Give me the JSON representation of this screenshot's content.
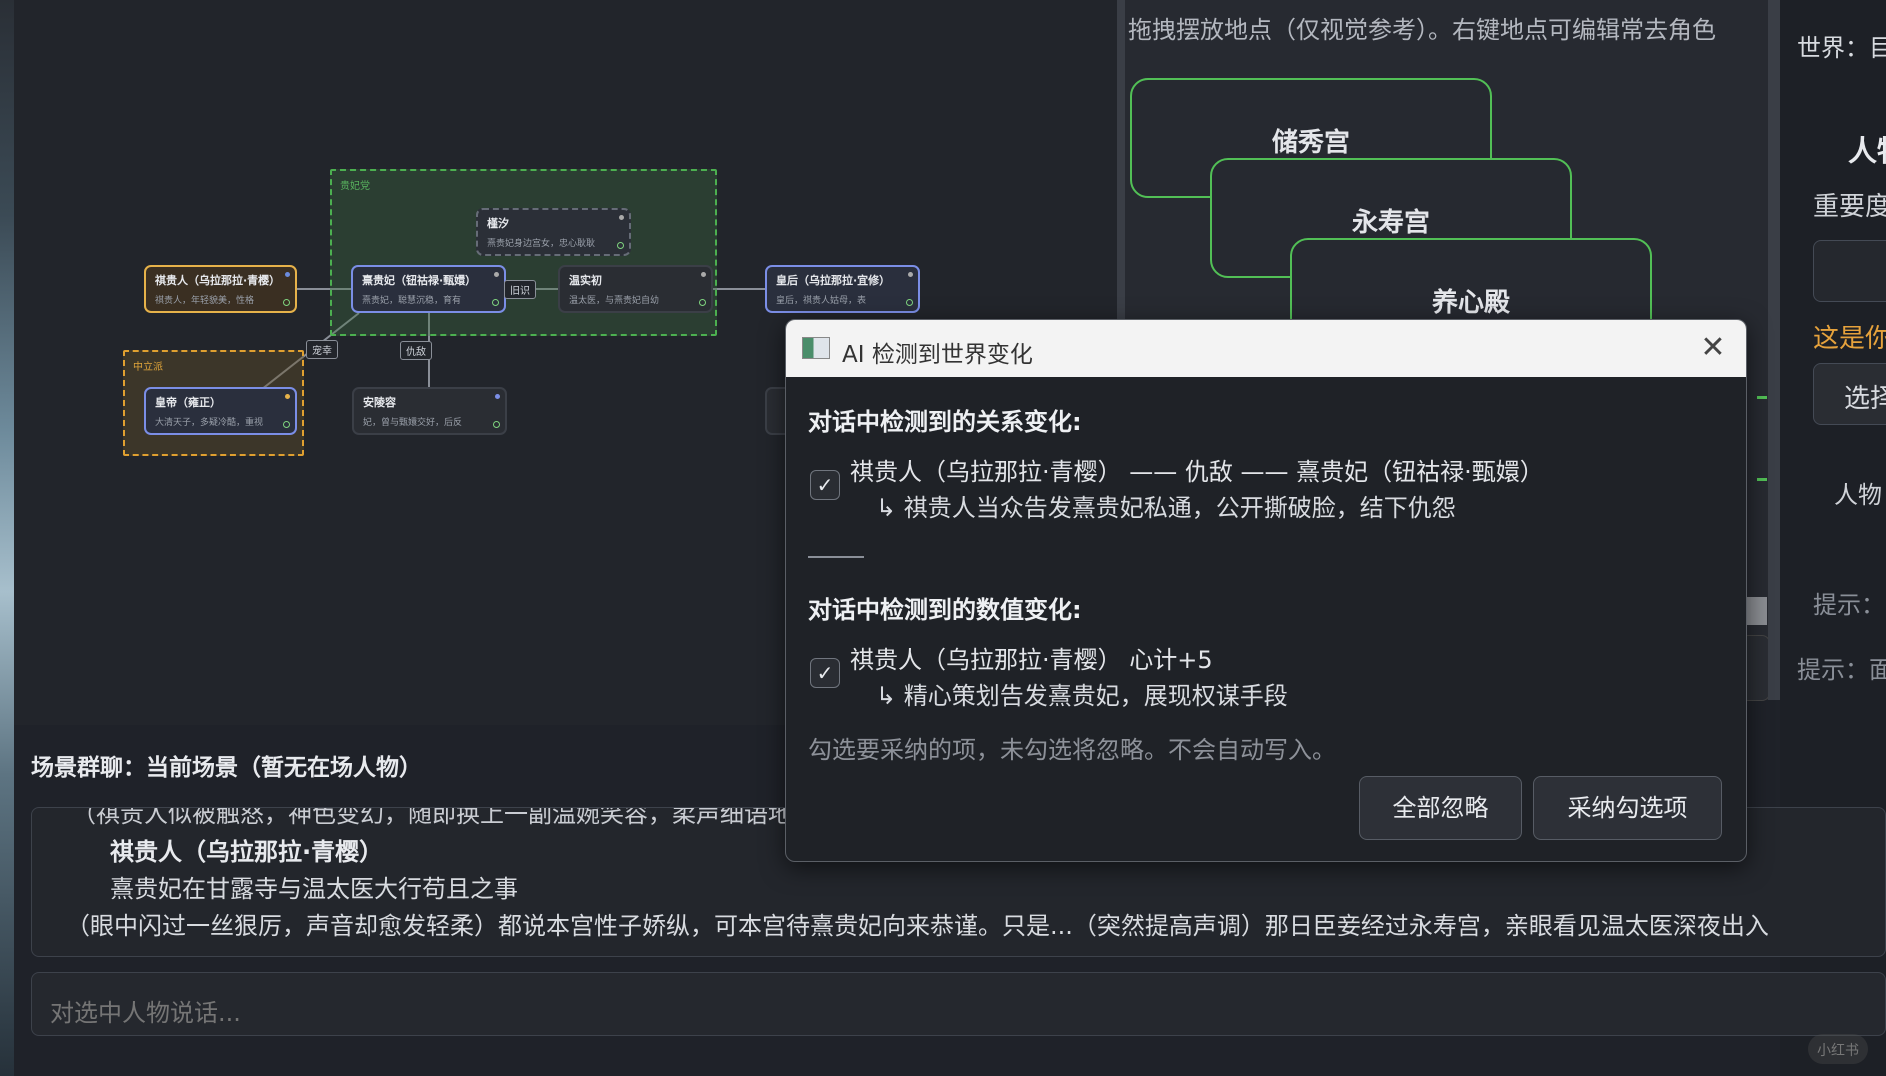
{
  "graph": {
    "factions": {
      "noble": "贵妃党",
      "neutral": "中立派"
    },
    "nodes": {
      "qi": {
        "name": "祺贵人（乌拉那拉·青樱）",
        "desc": "祺贵人，年轻貌美，性格"
      },
      "xi": {
        "name": "熹贵妃（钮祜禄·甄嬛）",
        "desc": "熹贵妃，聪慧沉稳，育有"
      },
      "jin": {
        "name": "槿汐",
        "desc": "熹贵妃身边宫女，忠心耿耿"
      },
      "wen": {
        "name": "温实初",
        "desc": "温太医，与熹贵妃自幼"
      },
      "hh": {
        "name": "皇后（乌拉那拉·宜修）",
        "desc": "皇后，祺贵人姑母，表"
      },
      "hd": {
        "name": "皇帝（雍正）",
        "desc": "大清天子，多疑冷酷，重视"
      },
      "an": {
        "name": "安陵容",
        "desc": "妃，曾与甄嬛交好，后反"
      },
      "part": {
        "name": "",
        "desc": ""
      }
    },
    "edges": {
      "old": "旧识",
      "rival": "仇敌",
      "favor": "宠幸"
    }
  },
  "locations": {
    "hint": "拖拽摆放地点（仅视觉参考）。右键地点可编辑常去角色",
    "items": [
      "储秀宫",
      "永寿宫",
      "养心殿"
    ]
  },
  "right_panel": {
    "world": "世界：目",
    "card_title": "人物卡",
    "importance": "重要度",
    "orange_text": "这是你",
    "select_btn": "选择",
    "person": "人物",
    "tip1": "提示：",
    "tip2": "提示：面"
  },
  "chat": {
    "title": "场景群聊：当前场景（暂无在场人物）",
    "cut_line": "（祺贵人似被触怒，神色变幻，随即换上一副温婉笑容，柔声细语地说着什么，眼底却冷意翻涌，嘴角的笑意令人发寒……）",
    "speaker": "祺贵人（乌拉那拉·青樱）",
    "line1": "熹贵妃在甘露寺与温太医大行苟且之事",
    "line2": "（眼中闪过一丝狠厉，声音却愈发轻柔）都说本宫性子娇纵，可本宫待熹贵妃向来恭谨。只是...（突然提高声调）那日臣妾经过永寿宫，亲眼看见温太医深夜出入",
    "input_placeholder": "对选中人物说话..."
  },
  "dialog": {
    "title": "AI 检测到世界变化",
    "relation_heading": "对话中检测到的关系变化:",
    "relation_item": "祺贵人（乌拉那拉·青樱） —— 仇敌 —— 熹贵妃（钮祜禄·甄嬛）",
    "relation_reason": "↳ 祺贵人当众告发熹贵妃私通，公开撕破脸，结下仇怨",
    "value_heading": "对话中检测到的数值变化:",
    "value_item": "祺贵人（乌拉那拉·青樱） 心计+5",
    "value_reason": "↳ 精心策划告发熹贵妃，展现权谋手段",
    "note": "勾选要采纳的项，未勾选将忽略。不会自动写入。",
    "ignore_all": "全部忽略",
    "accept_checked": "采纳勾选项",
    "check_mark": "✓",
    "close_glyph": "✕"
  },
  "watermark": "小红书"
}
